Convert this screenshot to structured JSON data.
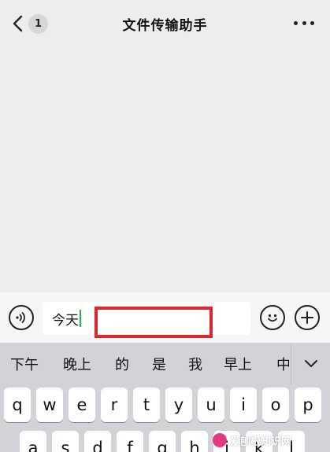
{
  "header": {
    "back_icon": "chevron-left-icon",
    "badge_count": "1",
    "title": "文件传输助手",
    "more_icon": "more-icon"
  },
  "input_bar": {
    "voice_icon": "voice-icon",
    "input_value": "今天",
    "emoji_icon": "emoji-icon",
    "plus_icon": "plus-icon",
    "highlight_color": "#e0262d"
  },
  "keyboard": {
    "candidates": [
      "下午",
      "晚上",
      "的",
      "是",
      "我",
      "早上",
      "中"
    ],
    "expand_icon": "chevron-down-icon",
    "row1": [
      "q",
      "w",
      "e",
      "r",
      "t",
      "y",
      "u",
      "i",
      "o",
      "p"
    ],
    "row2": [
      "a",
      "s",
      "d",
      "f",
      "g",
      "h",
      "j",
      "k",
      "l"
    ]
  },
  "watermark": {
    "text": "爱刨根知识网"
  }
}
